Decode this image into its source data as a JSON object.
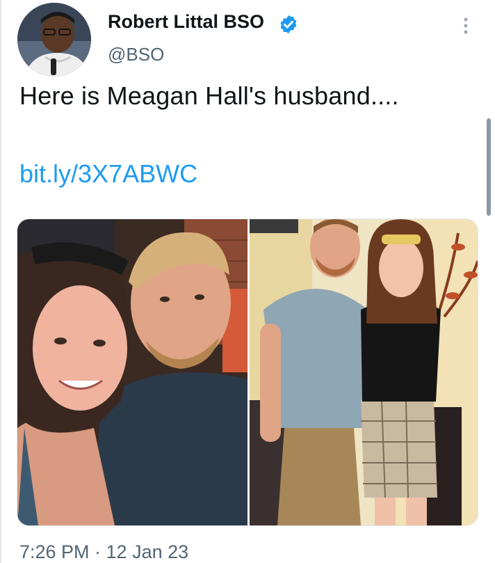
{
  "author": {
    "display_name": "Robert Littal BSO",
    "handle": "@BSO",
    "verified": true
  },
  "tweet": {
    "text": "Here is Meagan Hall's husband....",
    "link": "bit.ly/3X7ABWC",
    "timestamp": "7:26 PM · 12 Jan 23"
  },
  "media": {
    "photos": [
      {
        "description_icon": "photo-selfie"
      },
      {
        "description_icon": "photo-couple-standing"
      }
    ]
  },
  "icons": {
    "verified": "verified-badge-icon",
    "more": "more-options-icon"
  },
  "colors": {
    "link": "#1d9bf0",
    "verified": "#1d9bf0",
    "secondary_text": "#536471"
  }
}
